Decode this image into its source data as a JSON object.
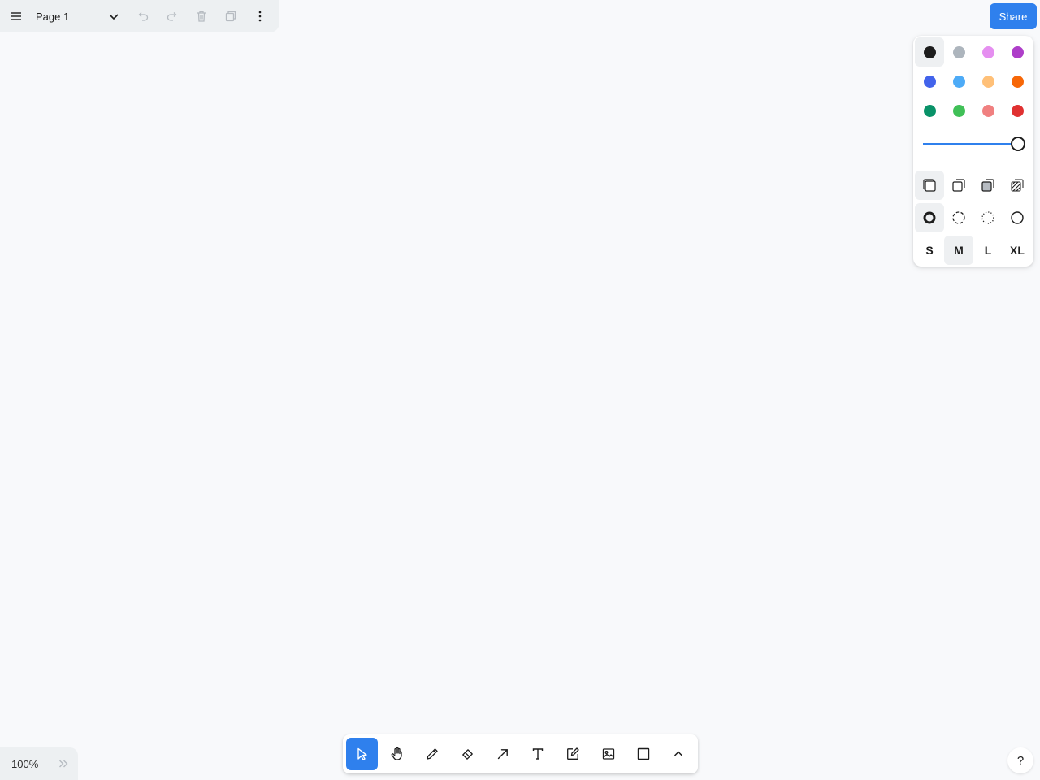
{
  "menu": {
    "page_name": "Page 1"
  },
  "share": {
    "label": "Share"
  },
  "style_panel": {
    "colors": [
      {
        "name": "black",
        "hex": "#1d1d1d",
        "selected": true
      },
      {
        "name": "grey",
        "hex": "#adb5bd",
        "selected": false
      },
      {
        "name": "light-violet",
        "hex": "#e58ff0",
        "selected": false
      },
      {
        "name": "violet",
        "hex": "#ae3ec9",
        "selected": false
      },
      {
        "name": "blue",
        "hex": "#4263eb",
        "selected": false
      },
      {
        "name": "light-blue",
        "hex": "#4dabf7",
        "selected": false
      },
      {
        "name": "yellow",
        "hex": "#ffc078",
        "selected": false
      },
      {
        "name": "orange",
        "hex": "#f76707",
        "selected": false
      },
      {
        "name": "green",
        "hex": "#099268",
        "selected": false
      },
      {
        "name": "light-green",
        "hex": "#40c057",
        "selected": false
      },
      {
        "name": "light-red",
        "hex": "#f08080",
        "selected": false
      },
      {
        "name": "red",
        "hex": "#e03131",
        "selected": false
      }
    ],
    "opacity": 1.0,
    "fill_selected": "none",
    "dash_selected": "draw",
    "sizes": [
      {
        "key": "s",
        "label": "S",
        "selected": false
      },
      {
        "key": "m",
        "label": "M",
        "selected": true
      },
      {
        "key": "l",
        "label": "L",
        "selected": false
      },
      {
        "key": "xl",
        "label": "XL",
        "selected": false
      }
    ]
  },
  "toolbar": {
    "active_tool": "select",
    "accent": "#2f80ed"
  },
  "zoom": {
    "label": "100%"
  },
  "help": {
    "label": "?"
  }
}
